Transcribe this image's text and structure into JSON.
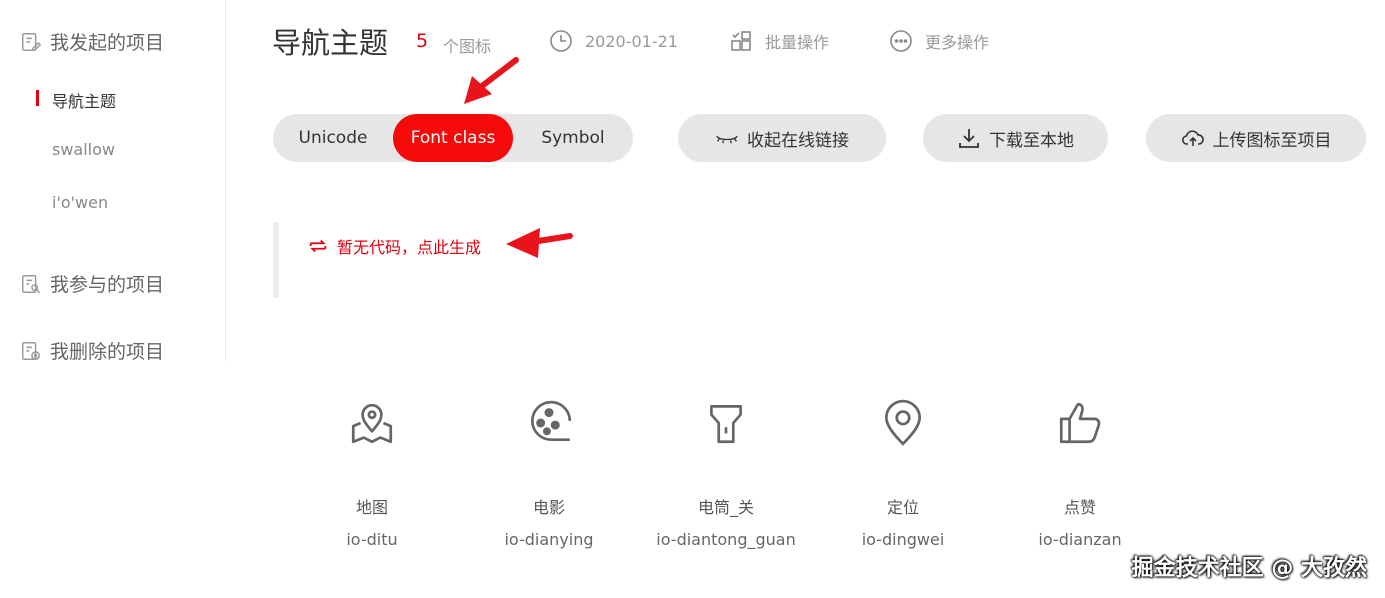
{
  "sidebar": {
    "groups": [
      {
        "label": "我发起的项目",
        "icon": "edit-doc-icon"
      },
      {
        "label": "我参与的项目",
        "icon": "doc-search-icon"
      },
      {
        "label": "我删除的项目",
        "icon": "doc-delete-icon"
      }
    ],
    "projects": [
      {
        "label": "导航主题",
        "active": true
      },
      {
        "label": "swallow",
        "active": false
      },
      {
        "label": "i'o'wen",
        "active": false
      }
    ]
  },
  "header": {
    "title": "导航主题",
    "icon_count": "5",
    "icon_count_label": "个图标",
    "date": "2020-01-21",
    "batch_label": "批量操作",
    "more_label": "更多操作"
  },
  "tabs": [
    {
      "label": "Unicode",
      "active": false
    },
    {
      "label": "Font class",
      "active": true
    },
    {
      "label": "Symbol",
      "active": false
    }
  ],
  "actions": {
    "collapse_link": "收起在线链接",
    "download": "下载至本地",
    "upload": "上传图标至项目"
  },
  "code": {
    "empty_message": "暂无代码，点此生成"
  },
  "icons": [
    {
      "name": "地图",
      "code": "io-ditu",
      "icon": "map-pin-icon"
    },
    {
      "name": "电影",
      "code": "io-dianying",
      "icon": "film-reel-icon"
    },
    {
      "name": "电筒_关",
      "code": "io-diantong_guan",
      "icon": "flashlight-icon"
    },
    {
      "name": "定位",
      "code": "io-dingwei",
      "icon": "location-icon"
    },
    {
      "name": "点赞",
      "code": "io-dianzan",
      "icon": "thumbs-up-icon"
    }
  ],
  "watermark": "掘金技术社区 @ 大孜然",
  "colors": {
    "accent": "#e60012",
    "pill_bg": "#e6e6e6",
    "tab_active": "#f50a0a"
  }
}
